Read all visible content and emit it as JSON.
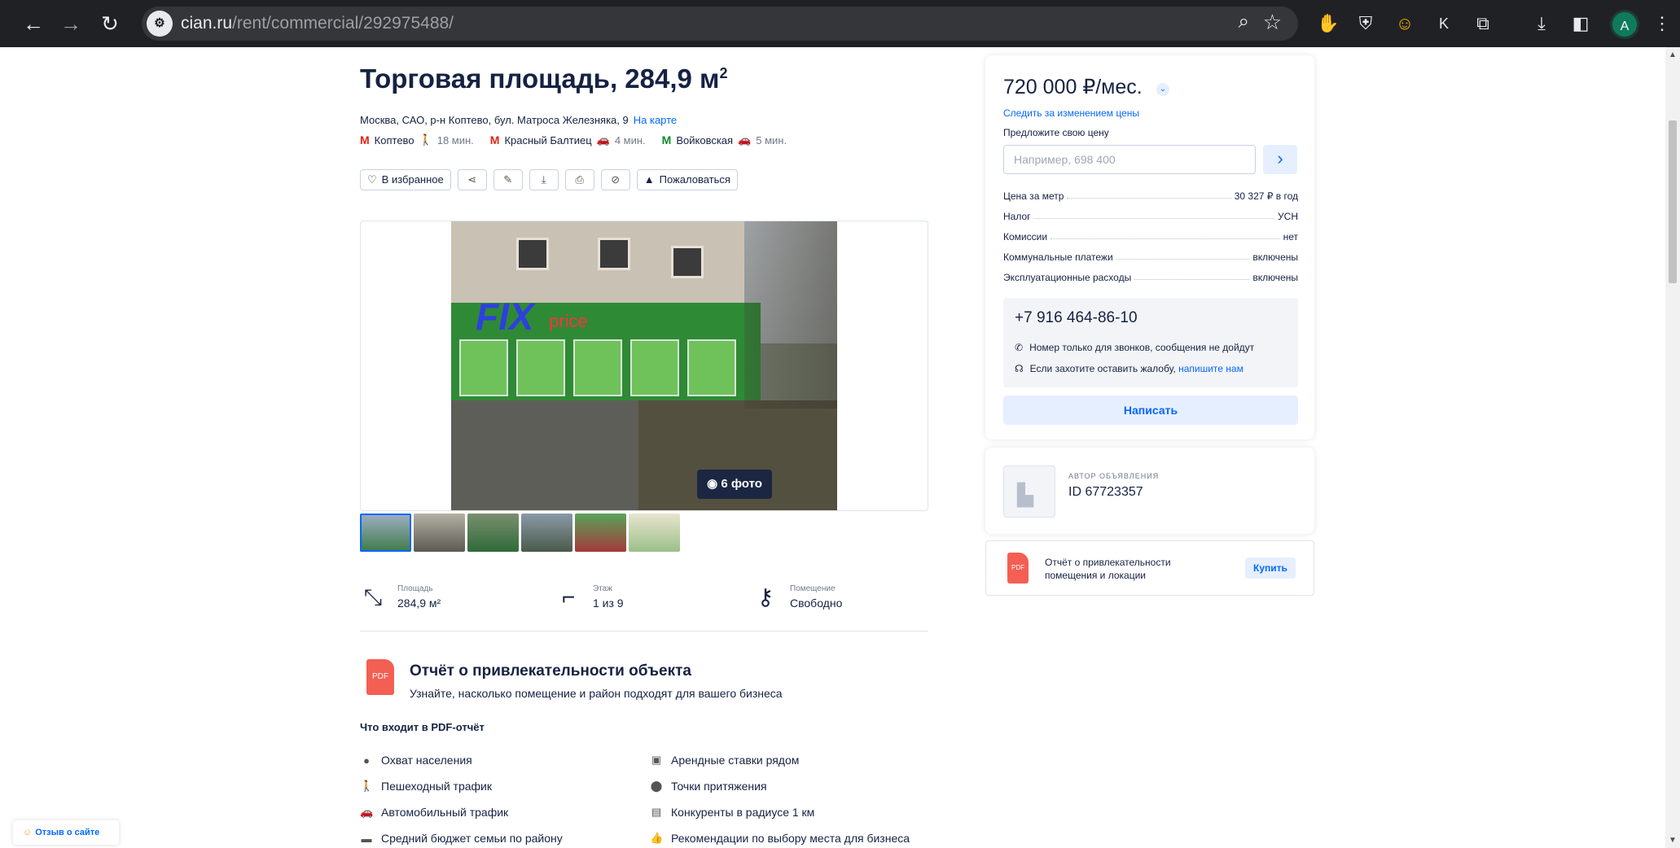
{
  "browser": {
    "url_host": "cian.ru",
    "url_path": "/rent/commercial/292975488/",
    "avatar_letter": "A",
    "ext_k_label": "K"
  },
  "listing": {
    "title": "Торговая площадь, 284,9 м",
    "title_sup": "2",
    "address": "Москва, САО, р-н Коптево, бул. Матроса Железняка, 9",
    "map_link": "На карте",
    "metro": [
      {
        "name": "Коптево",
        "time": "18 мин.",
        "mode_icon": "walk-icon",
        "color": "#e42313"
      },
      {
        "name": "Красный Балтиец",
        "time": "4 мин.",
        "mode_icon": "car-icon",
        "color": "#e42313"
      },
      {
        "name": "Войковская",
        "time": "5 мин.",
        "mode_icon": "car-icon",
        "color": "#0e8c2b"
      }
    ],
    "actions": {
      "favorite": "В избранное",
      "complain": "Пожаловаться"
    },
    "photo_count": "6 фото",
    "facts": [
      {
        "label": "Площадь",
        "value": "284,9 м²",
        "icon": "area-icon"
      },
      {
        "label": "Этаж",
        "value": "1 из 9",
        "icon": "stairs-icon"
      },
      {
        "label": "Помещение",
        "value": "Свободно",
        "icon": "key-icon"
      }
    ],
    "report": {
      "title": "Отчёт о привлекательности объекта",
      "subtitle": "Узнайте, насколько помещение и район подходят для вашего бизнеса",
      "what_included": "Что входит в PDF-отчёт",
      "pdf_label": "PDF",
      "items_left": [
        "Охват населения",
        "Пешеходный трафик",
        "Автомобильный трафик",
        "Средний бюджет семьи по району"
      ],
      "items_right": [
        "Арендные ставки рядом",
        "Точки притяжения",
        "Конкуренты в радиусе 1 км",
        "Рекомендации по выбору места для бизнеса"
      ]
    }
  },
  "price_card": {
    "price": "720 000 ₽/мес.",
    "track_link": "Следить за изменением цены",
    "offer_label": "Предложите свою цену",
    "offer_placeholder": "Например, 698 400",
    "specs": [
      {
        "label": "Цена за метр",
        "value": "30 327 ₽ в год"
      },
      {
        "label": "Налог",
        "value": "УСН"
      },
      {
        "label": "Комиссии",
        "value": "нет"
      },
      {
        "label": "Коммунальные платежи",
        "value": "включены"
      },
      {
        "label": "Эксплуатационные расходы",
        "value": "включены"
      }
    ],
    "phone": "+7 916 464-86-10",
    "phone_note": "Номер только для звонков, сообщения не дойдут",
    "complaint_note": "Если захотите оставить жалобу,",
    "complaint_link": "напишите нам",
    "write_button": "Написать"
  },
  "author": {
    "label": "АВТОР ОБЪЯВЛЕНИЯ",
    "id": "ID 67723357"
  },
  "buy_card": {
    "text": "Отчёт о привлекательности помещения и локации",
    "button": "Купить",
    "pdf_label": "PDF"
  },
  "feedback": {
    "label": "Отзыв о сайте"
  },
  "colors": {
    "accent": "#0468ff",
    "text": "#152242",
    "accent_bg": "#e6efff"
  }
}
